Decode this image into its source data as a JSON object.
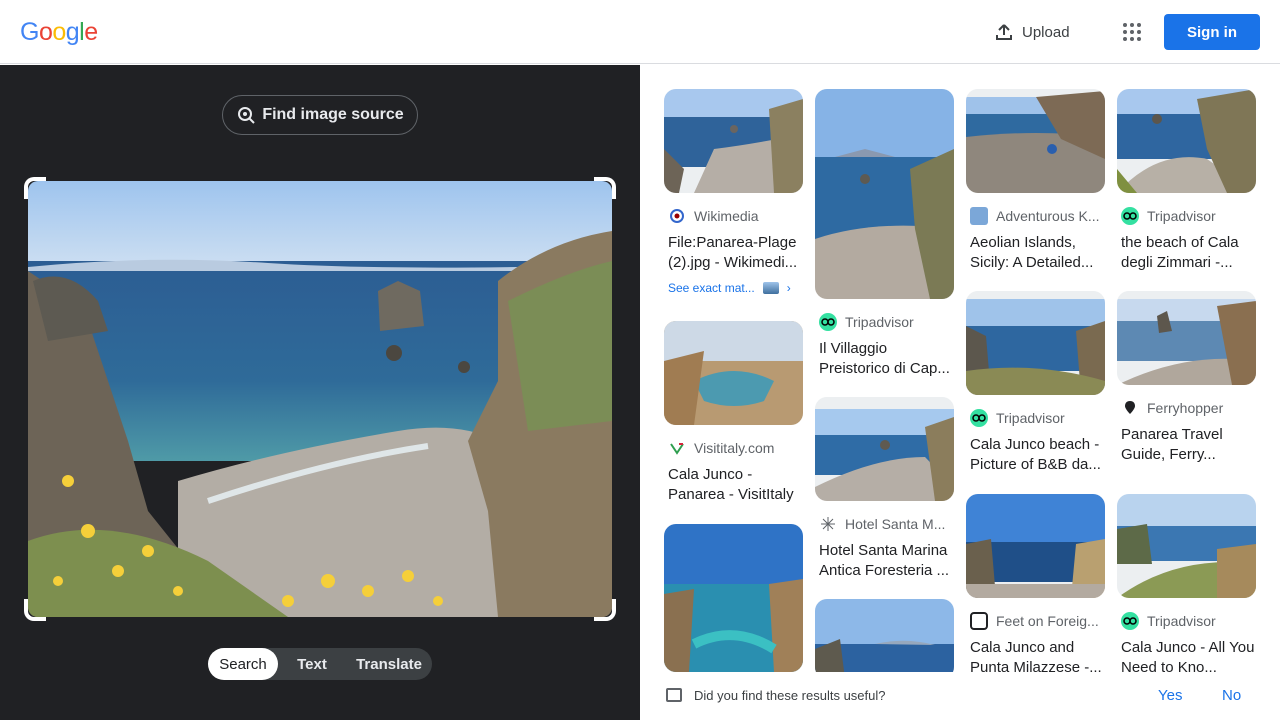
{
  "header": {
    "logo_letters": [
      "G",
      "o",
      "o",
      "g",
      "l",
      "e"
    ],
    "logo_colors": [
      "#4285F4",
      "#EA4335",
      "#FBBC05",
      "#4285F4",
      "#34A853",
      "#EA4335"
    ],
    "upload_label": "Upload",
    "signin_label": "Sign in"
  },
  "left": {
    "find_source_label": "Find image source",
    "modes": [
      "Search",
      "Text",
      "Translate"
    ],
    "active_mode": "Search"
  },
  "results": [
    {
      "source": "Wikimedia",
      "title": "File:Panarea-Plage (2).jpg - Wikimedi...",
      "exact": "See exact mat..."
    },
    {
      "source": "Visititaly.com",
      "title": "Cala Junco - Panarea - VisitItaly"
    },
    {
      "source": "Tripadvisor",
      "title": "Il Villaggio Preistorico di Cap..."
    },
    {
      "source": "Hotel Santa M...",
      "title": "Hotel Santa Marina Antica Foresteria ..."
    },
    {
      "source": "Adventurous K...",
      "title": "Aeolian Islands, Sicily: A Detailed..."
    },
    {
      "source": "Tripadvisor",
      "title": "Cala Junco beach - Picture of B&B da..."
    },
    {
      "source": "Feet on Foreig...",
      "title": "Cala Junco and Punta Milazzese -..."
    },
    {
      "source": "Tripadvisor",
      "title": "the beach of Cala degli Zimmari -..."
    },
    {
      "source": "Ferryhopper",
      "title": "Panarea Travel Guide, Ferry..."
    },
    {
      "source": "Tripadvisor",
      "title": "Cala Junco - All You Need to Kno..."
    }
  ],
  "feedback": {
    "question": "Did you find these results useful?",
    "yes": "Yes",
    "no": "No"
  },
  "colors": {
    "accent": "#1a73e8",
    "dark_panel": "#202124",
    "tripadvisor": "#34E0A1"
  }
}
